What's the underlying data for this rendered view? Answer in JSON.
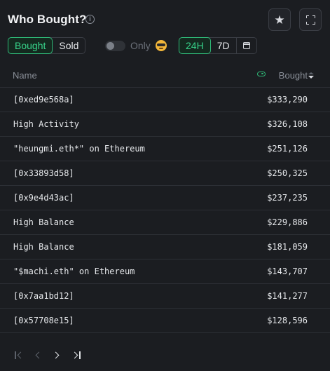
{
  "header": {
    "title": "Who Bought?",
    "info_glyph": "i"
  },
  "tabs": [
    {
      "label": "Bought",
      "active": true
    },
    {
      "label": "Sold",
      "active": false
    }
  ],
  "only_toggle": {
    "label": "Only",
    "on": false
  },
  "time_ranges": [
    {
      "label": "24H",
      "active": true
    },
    {
      "label": "7D",
      "active": false
    }
  ],
  "table": {
    "columns": {
      "name": "Name",
      "value": "Bought"
    },
    "rows": [
      {
        "name": "[0xed9e568a]",
        "value": "$333,290"
      },
      {
        "name": "High Activity",
        "value": "$326,108"
      },
      {
        "name": "\"heungmi.eth*\" on Ethereum",
        "value": "$251,126"
      },
      {
        "name": "[0x33893d58]",
        "value": "$250,325"
      },
      {
        "name": "[0x9e4d43ac]",
        "value": "$237,235"
      },
      {
        "name": "High Balance",
        "value": "$229,886"
      },
      {
        "name": "High Balance",
        "value": "$181,059"
      },
      {
        "name": "\"$machi.eth\" on Ethereum",
        "value": "$143,707"
      },
      {
        "name": "[0x7aa1bd12]",
        "value": "$141,277"
      },
      {
        "name": "[0x57708e15]",
        "value": "$128,596"
      }
    ]
  },
  "colors": {
    "background": "#1b1d21",
    "accent_green": "#2fb877",
    "text": "#e6e8eb",
    "muted": "#8a8f98"
  },
  "icons": [
    "info-icon",
    "star-icon",
    "expand-icon",
    "toggle-switch",
    "sunglasses-emoji-icon",
    "calendar-icon",
    "wallet-pill-icon",
    "sort-desc-icon",
    "first-page-icon",
    "prev-page-icon",
    "next-page-icon",
    "last-page-icon"
  ]
}
